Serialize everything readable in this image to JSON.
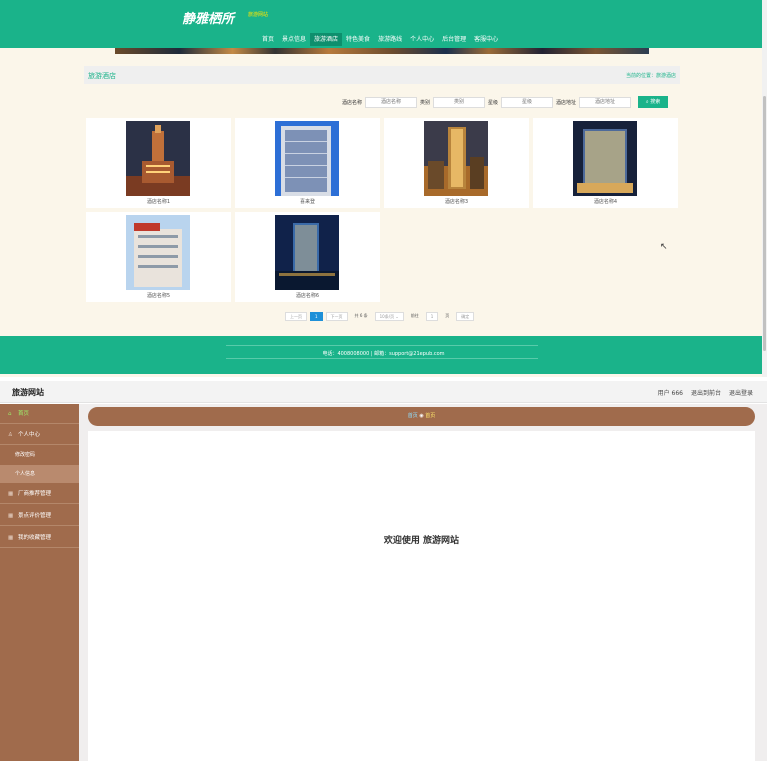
{
  "site": {
    "logo": "静雅栖所",
    "logo_sub": "旅游网站",
    "nav": [
      "首页",
      "景点信息",
      "旅游酒店",
      "特色美食",
      "旅游路线",
      "个人中心",
      "后台管理",
      "客服中心"
    ],
    "panel_title": "旅游酒店",
    "breadcrumb": "当前的位置：旅游酒店",
    "search": {
      "fields": [
        {
          "label": "酒店名称",
          "placeholder": "酒店名称"
        },
        {
          "label": "类别",
          "placeholder": "类别"
        },
        {
          "label": "星级",
          "placeholder": "星级"
        },
        {
          "label": "酒店地址",
          "placeholder": "酒店地址"
        }
      ],
      "button": "搜索"
    },
    "hotels": [
      {
        "name": "酒店名称1"
      },
      {
        "name": "喜来登"
      },
      {
        "name": "酒店名称3"
      },
      {
        "name": "酒店名称4"
      },
      {
        "name": "酒店名称5"
      },
      {
        "name": "酒店名称6"
      }
    ],
    "pager": {
      "prev": "上一页",
      "current": "1",
      "next": "下一页",
      "total": "共 6 条",
      "page_size": "10条/页 ⌄",
      "goto_label": "前往",
      "goto_value": "1",
      "page_unit": "页",
      "confirm": "确定"
    },
    "footer": "电话：4008008000 | 邮箱：support@21epub.com"
  },
  "admin": {
    "brand": "旅游网站",
    "links": [
      "用户 666",
      "退出到前台",
      "退出登录"
    ],
    "sidebar": [
      {
        "label": "首页",
        "icon": "home-icon"
      },
      {
        "label": "个人中心",
        "icon": "user-icon"
      },
      {
        "label": "厂商推荐管理",
        "icon": "grid-icon"
      },
      {
        "label": "景点评价管理",
        "icon": "grid-icon"
      },
      {
        "label": "我的收藏管理",
        "icon": "grid-icon"
      }
    ],
    "sidebar_sub": [
      "修改密码",
      "个人信息"
    ],
    "crumb_home": "首页",
    "crumb_sep": "◉",
    "crumb_current": "首页",
    "welcome": "欢迎使用 旅游网站"
  }
}
